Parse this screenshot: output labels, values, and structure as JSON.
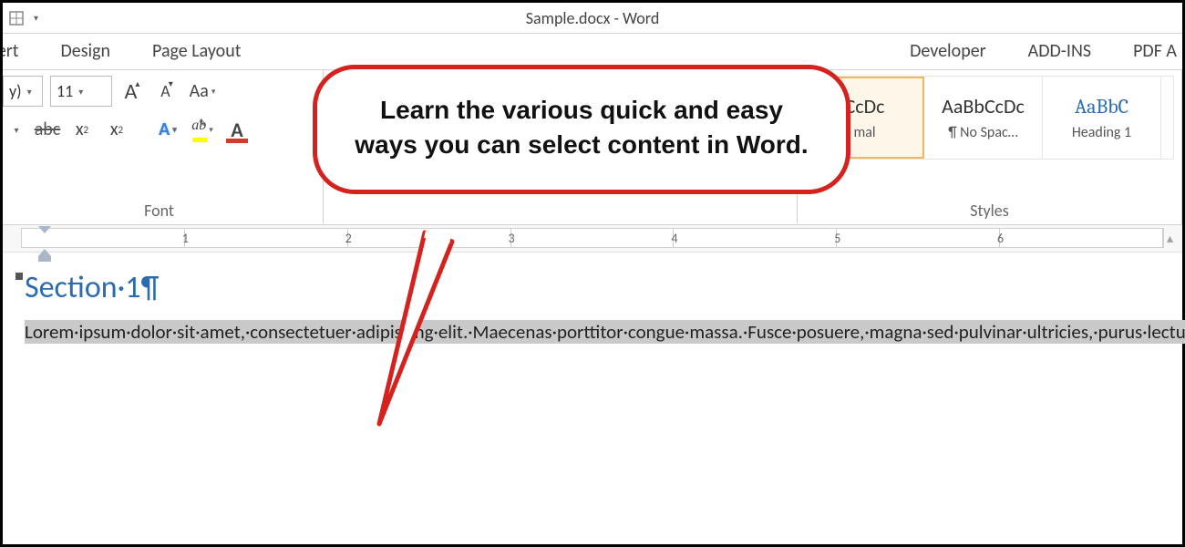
{
  "title": "Sample.docx - Word",
  "tabs": [
    "sert",
    "Design",
    "Page Layout",
    "Developer",
    "ADD-INS",
    "PDF A"
  ],
  "font": {
    "family_fragment": "y)",
    "size": "11",
    "grow_label": "A",
    "shrink_label": "A",
    "case_label": "Aa",
    "strike": "abc",
    "subscript_base": "x",
    "subscript_sub": "2",
    "superscript_base": "x",
    "superscript_sup": "2",
    "text_effects": "A",
    "highlight_glyph": "ab",
    "font_color_glyph": "A",
    "group_label": "Font"
  },
  "styles": {
    "group_label": "Styles",
    "tiles": [
      {
        "preview": "CcDc",
        "name": "mal",
        "selected": true,
        "heading": false
      },
      {
        "preview": "AaBbCcDc",
        "name": "¶ No Spac…",
        "selected": false,
        "heading": false
      },
      {
        "preview": "AaBbC",
        "name": "Heading 1",
        "selected": false,
        "heading": true
      }
    ]
  },
  "ruler": {
    "marks": [
      "1",
      "2",
      "3",
      "4",
      "5",
      "6"
    ]
  },
  "doc": {
    "heading": "Section·1",
    "pilcrow": "¶",
    "body": "Lorem·ipsum·dolor·sit·amet,·consectetuer·adipiscing·elit.·Maecenas·porttitor·congue·massa.·Fusce·posuere,·magna·sed·pulvinar·ultricies,·purus·lectus·malesuada·libero,·sit·amet·commodo·magna·eros·quis·urna.·Nunc·viverra·imperdiet·enim.·Fusce·est.·Vivamus·a·tellus.·Pellentesque·habitant·morbi·tristique·senectus·et·netus·et·malesuada·fames·ac·turpis·egestas.·Proin·pharetra·nonummy·pede.·Mauris·et·orci.·Aenean·nec·lorem.·In·porttitor.·Donec·laoreet·nonummy·augue.·Suspendisse·dui·purus,·"
  },
  "callout": {
    "text": "Learn the various quick and easy ways you can select content in Word."
  }
}
